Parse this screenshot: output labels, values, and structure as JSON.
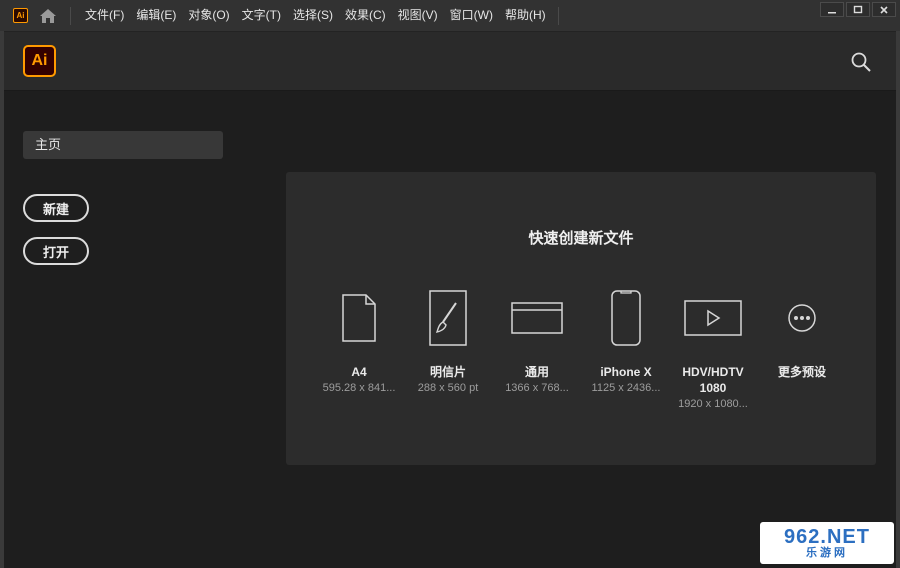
{
  "titlebar": {
    "app_icon_text": "Ai",
    "menu": [
      "文件(F)",
      "编辑(E)",
      "对象(O)",
      "文字(T)",
      "选择(S)",
      "效果(C)",
      "视图(V)",
      "窗口(W)",
      "帮助(H)"
    ],
    "icons": [
      "home-icon",
      "minimize-icon",
      "maximize-icon",
      "close-icon"
    ]
  },
  "header": {
    "logo_text": "Ai",
    "search_icon": "search-icon"
  },
  "sidebar": {
    "home_label": "主页",
    "new_label": "新建",
    "open_label": "打开"
  },
  "quick_create": {
    "title": "快速创建新文件",
    "presets": [
      {
        "name": "A4",
        "size": "595.28 x 841...",
        "icon": "document-icon"
      },
      {
        "name": "明信片",
        "size": "288 x 560 pt",
        "icon": "postcard-brush-icon"
      },
      {
        "name": "通用",
        "size": "1366 x 768...",
        "icon": "web-window-icon"
      },
      {
        "name": "iPhone X",
        "size": "1125 x 2436...",
        "icon": "phone-icon"
      },
      {
        "name": "HDV/HDTV 1080",
        "size": "1920 x 1080...",
        "icon": "video-play-icon"
      },
      {
        "name": "更多预设",
        "size": "",
        "icon": "more-dots-icon"
      }
    ]
  },
  "watermark": {
    "big": "962.NET",
    "small": "乐游网"
  },
  "colors": {
    "accent": "#ff9a00",
    "background": "#1e1e1e",
    "panel": "#2c2c2c",
    "header": "#2a2a2a"
  }
}
